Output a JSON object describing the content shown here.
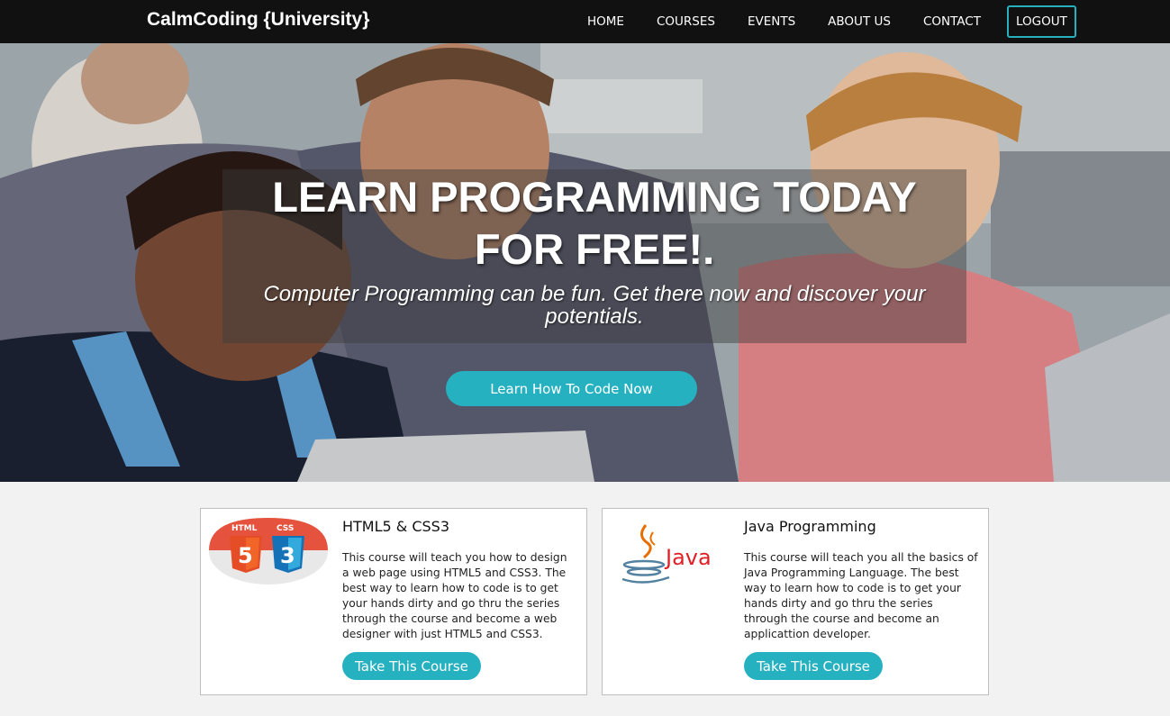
{
  "navbar": {
    "brand": "CalmCoding {University}",
    "links": [
      "HOME",
      "COURSES",
      "EVENTS",
      "ABOUT US",
      "CONTACT"
    ],
    "logout_label": "LOGOUT",
    "background_color": "#111111",
    "accent_color": "#26b1c0"
  },
  "hero": {
    "title_line1": "LEARN PROGRAMMING TODAY",
    "title_line2": "FOR FREE!.",
    "subtitle": "Computer Programming can be fun. Get there now and discover your potentials.",
    "cta_label": "Learn How To Code Now"
  },
  "courses": [
    {
      "logo_name": "html5-css3-logo",
      "logo_text_left": "HTML",
      "logo_text_right": "CSS",
      "title": "HTML5 & CSS3",
      "description": "This course will teach you how to design a web page using HTML5 and CSS3. The best way to learn how to code is to get your hands dirty and go thru the series through the course and become a web designer with just HTML5 and CSS3.",
      "button_label": "Take This Course"
    },
    {
      "logo_name": "java-logo",
      "logo_text": "Java",
      "title": "Java Programming",
      "description": "This course will teach you all the basics of Java Programming Language. The best way to learn how to code is to get your hands dirty and go thru the series through the course and become an applicattion developer.",
      "button_label": "Take This Course"
    }
  ]
}
